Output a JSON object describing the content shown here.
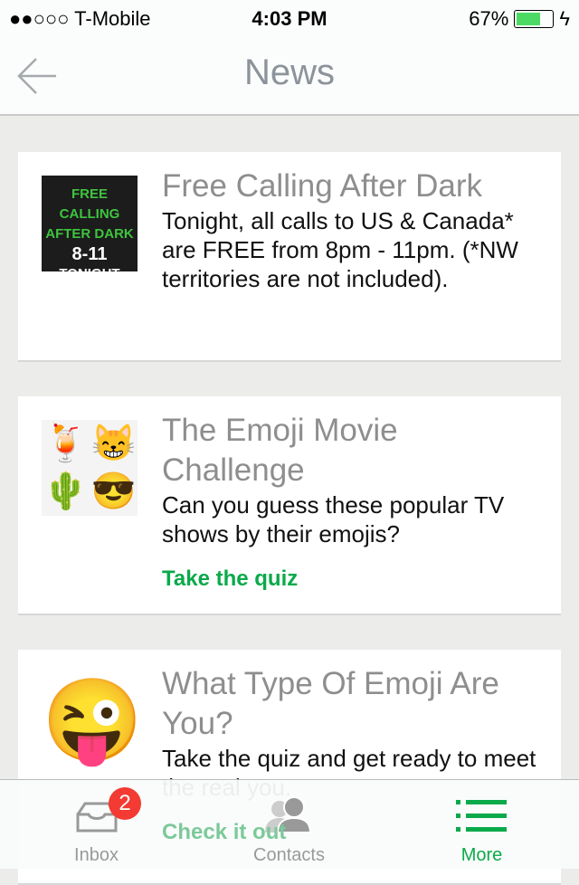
{
  "status": {
    "carrier": "●●○○○ T-Mobile",
    "time": "4:03 PM",
    "battery": "67%",
    "battery_level": 0.67
  },
  "nav": {
    "title": "News",
    "back_icon": "arrow-left-icon"
  },
  "cards": [
    {
      "title": "Free Calling After Dark",
      "thumb_text": [
        "FREE CALLING",
        "AFTER DARK",
        "8-11",
        "TONIGHT"
      ],
      "text": "Tonight, all calls to US & Canada* are FREE from 8pm - 11pm. (*NW territories are not included)."
    },
    {
      "title": "The Emoji Movie Challenge",
      "thumb_emojis": [
        "🍹",
        "😸",
        "🌵",
        "😎"
      ],
      "text": "Can you guess these popular TV shows by their emojis?",
      "link": "Take the quiz"
    },
    {
      "title": "What Type Of Emoji Are You?",
      "thumb_emoji": "😜",
      "text": "Take the quiz and get ready to meet the real you.",
      "link": "Check it out"
    }
  ],
  "tabs": [
    {
      "label": "Inbox",
      "badge": "2"
    },
    {
      "label": "Contacts"
    },
    {
      "label": "More"
    }
  ],
  "colors": {
    "accent": "#0aaa4a",
    "badge": "#f33a33"
  }
}
